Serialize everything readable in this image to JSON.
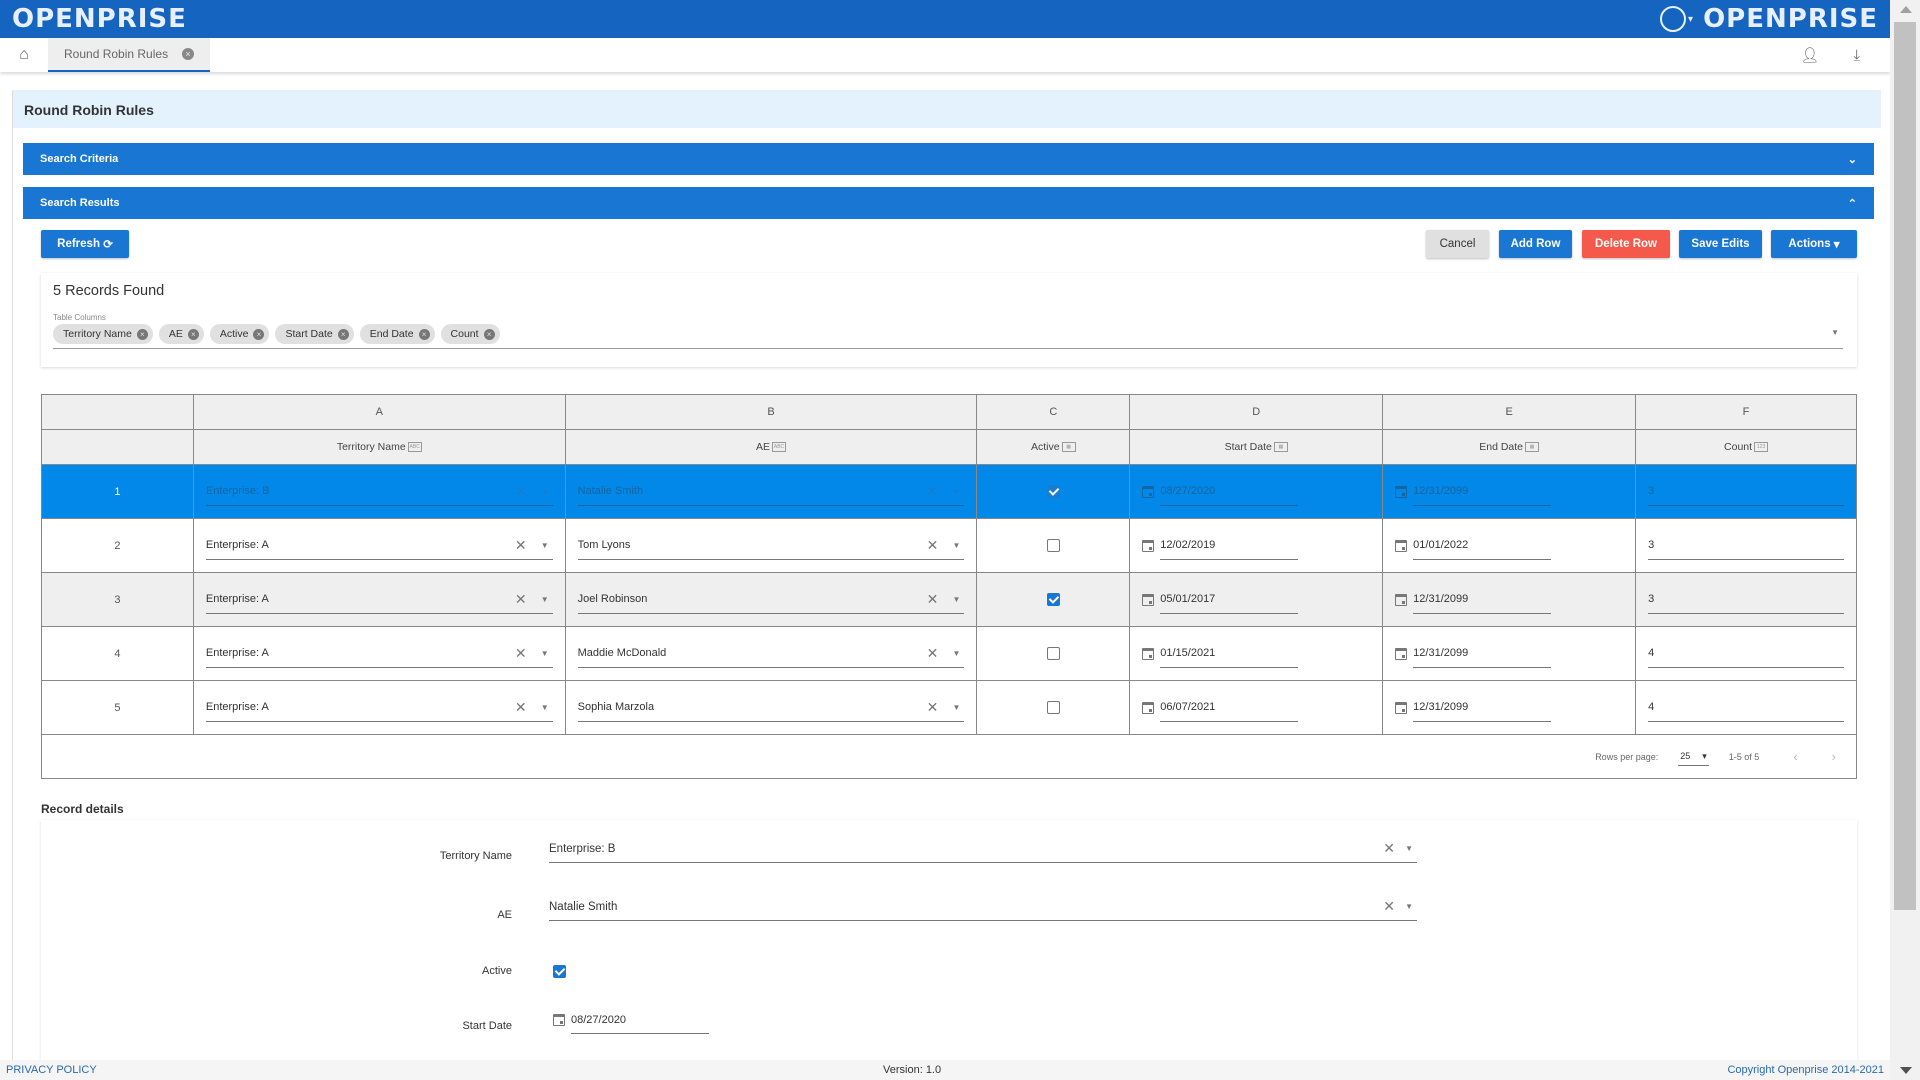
{
  "app": {
    "brand": "OPENPRISE",
    "brand_right": "OPENPRISE"
  },
  "tabs": [
    {
      "label": "Round Robin Rules"
    }
  ],
  "page": {
    "title": "Round Robin Rules",
    "search_criteria_label": "Search Criteria",
    "search_results_label": "Search Results"
  },
  "toolbar": {
    "refresh_label": "Refresh",
    "cancel_label": "Cancel",
    "add_row_label": "Add Row",
    "delete_row_label": "Delete Row",
    "save_edits_label": "Save Edits",
    "actions_label": "Actions"
  },
  "records": {
    "found_text": "5 Records Found",
    "columns_label": "Table Columns",
    "column_chips": [
      "Territory Name",
      "AE",
      "Active",
      "Start Date",
      "End Date",
      "Count"
    ]
  },
  "table": {
    "letters": [
      "A",
      "B",
      "C",
      "D",
      "E",
      "F"
    ],
    "headers": [
      {
        "label": "Territory Name",
        "type": "ABC"
      },
      {
        "label": "AE",
        "type": "ABC"
      },
      {
        "label": "Active",
        "type": "bool"
      },
      {
        "label": "Start Date",
        "type": "date"
      },
      {
        "label": "End Date",
        "type": "date"
      },
      {
        "label": "Count",
        "type": "123"
      }
    ],
    "rows": [
      {
        "num": "1",
        "territory": "Enterprise: B",
        "ae": "Natalie Smith",
        "active": true,
        "start": "08/27/2020",
        "end": "12/31/2099",
        "count": "3",
        "selected": true
      },
      {
        "num": "2",
        "territory": "Enterprise: A",
        "ae": "Tom Lyons",
        "active": false,
        "start": "12/02/2019",
        "end": "01/01/2022",
        "count": "3"
      },
      {
        "num": "3",
        "territory": "Enterprise: A",
        "ae": "Joel Robinson",
        "active": true,
        "start": "05/01/2017",
        "end": "12/31/2099",
        "count": "3",
        "hover": true
      },
      {
        "num": "4",
        "territory": "Enterprise: A",
        "ae": "Maddie McDonald",
        "active": false,
        "start": "01/15/2021",
        "end": "12/31/2099",
        "count": "4"
      },
      {
        "num": "5",
        "territory": "Enterprise: A",
        "ae": "Sophia Marzola",
        "active": false,
        "start": "06/07/2021",
        "end": "12/31/2099",
        "count": "4"
      }
    ]
  },
  "pager": {
    "rows_per_page_label": "Rows per page:",
    "rows_per_page": "25",
    "range": "1-5 of 5"
  },
  "record_details": {
    "title": "Record details",
    "territory_label": "Territory Name",
    "territory_value": "Enterprise: B",
    "ae_label": "AE",
    "ae_value": "Natalie Smith",
    "active_label": "Active",
    "active_value": true,
    "start_label": "Start Date",
    "start_value": "08/27/2020"
  },
  "footer": {
    "privacy": "PRIVACY POLICY",
    "version": "Version: 1.0",
    "copyright": "Copyright Openprise 2014-2021"
  }
}
